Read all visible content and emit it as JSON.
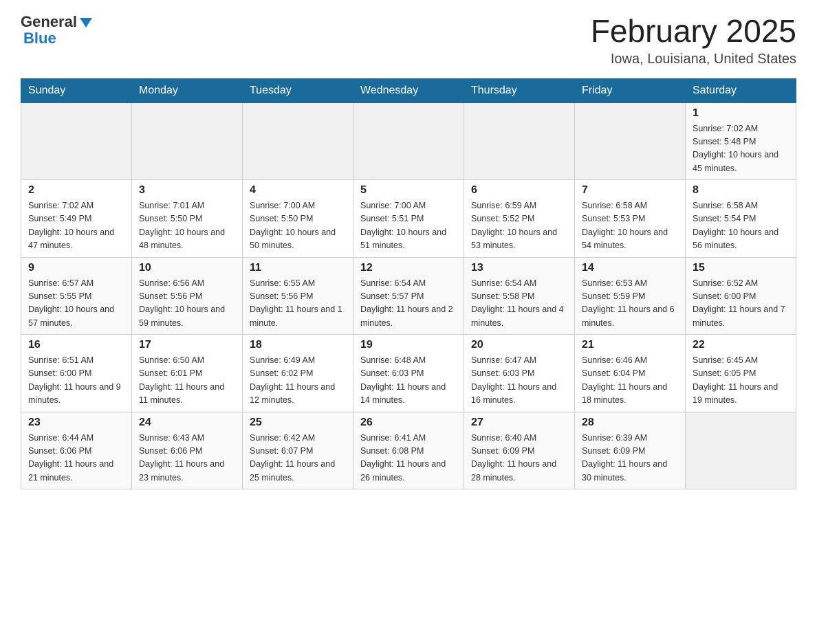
{
  "header": {
    "logo_general": "General",
    "logo_blue": "Blue",
    "month_title": "February 2025",
    "location": "Iowa, Louisiana, United States"
  },
  "days_of_week": [
    "Sunday",
    "Monday",
    "Tuesday",
    "Wednesday",
    "Thursday",
    "Friday",
    "Saturday"
  ],
  "weeks": [
    {
      "days": [
        {
          "number": "",
          "info": ""
        },
        {
          "number": "",
          "info": ""
        },
        {
          "number": "",
          "info": ""
        },
        {
          "number": "",
          "info": ""
        },
        {
          "number": "",
          "info": ""
        },
        {
          "number": "",
          "info": ""
        },
        {
          "number": "1",
          "info": "Sunrise: 7:02 AM\nSunset: 5:48 PM\nDaylight: 10 hours\nand 45 minutes."
        }
      ]
    },
    {
      "days": [
        {
          "number": "2",
          "info": "Sunrise: 7:02 AM\nSunset: 5:49 PM\nDaylight: 10 hours\nand 47 minutes."
        },
        {
          "number": "3",
          "info": "Sunrise: 7:01 AM\nSunset: 5:50 PM\nDaylight: 10 hours\nand 48 minutes."
        },
        {
          "number": "4",
          "info": "Sunrise: 7:00 AM\nSunset: 5:50 PM\nDaylight: 10 hours\nand 50 minutes."
        },
        {
          "number": "5",
          "info": "Sunrise: 7:00 AM\nSunset: 5:51 PM\nDaylight: 10 hours\nand 51 minutes."
        },
        {
          "number": "6",
          "info": "Sunrise: 6:59 AM\nSunset: 5:52 PM\nDaylight: 10 hours\nand 53 minutes."
        },
        {
          "number": "7",
          "info": "Sunrise: 6:58 AM\nSunset: 5:53 PM\nDaylight: 10 hours\nand 54 minutes."
        },
        {
          "number": "8",
          "info": "Sunrise: 6:58 AM\nSunset: 5:54 PM\nDaylight: 10 hours\nand 56 minutes."
        }
      ]
    },
    {
      "days": [
        {
          "number": "9",
          "info": "Sunrise: 6:57 AM\nSunset: 5:55 PM\nDaylight: 10 hours\nand 57 minutes."
        },
        {
          "number": "10",
          "info": "Sunrise: 6:56 AM\nSunset: 5:56 PM\nDaylight: 10 hours\nand 59 minutes."
        },
        {
          "number": "11",
          "info": "Sunrise: 6:55 AM\nSunset: 5:56 PM\nDaylight: 11 hours\nand 1 minute."
        },
        {
          "number": "12",
          "info": "Sunrise: 6:54 AM\nSunset: 5:57 PM\nDaylight: 11 hours\nand 2 minutes."
        },
        {
          "number": "13",
          "info": "Sunrise: 6:54 AM\nSunset: 5:58 PM\nDaylight: 11 hours\nand 4 minutes."
        },
        {
          "number": "14",
          "info": "Sunrise: 6:53 AM\nSunset: 5:59 PM\nDaylight: 11 hours\nand 6 minutes."
        },
        {
          "number": "15",
          "info": "Sunrise: 6:52 AM\nSunset: 6:00 PM\nDaylight: 11 hours\nand 7 minutes."
        }
      ]
    },
    {
      "days": [
        {
          "number": "16",
          "info": "Sunrise: 6:51 AM\nSunset: 6:00 PM\nDaylight: 11 hours\nand 9 minutes."
        },
        {
          "number": "17",
          "info": "Sunrise: 6:50 AM\nSunset: 6:01 PM\nDaylight: 11 hours\nand 11 minutes."
        },
        {
          "number": "18",
          "info": "Sunrise: 6:49 AM\nSunset: 6:02 PM\nDaylight: 11 hours\nand 12 minutes."
        },
        {
          "number": "19",
          "info": "Sunrise: 6:48 AM\nSunset: 6:03 PM\nDaylight: 11 hours\nand 14 minutes."
        },
        {
          "number": "20",
          "info": "Sunrise: 6:47 AM\nSunset: 6:03 PM\nDaylight: 11 hours\nand 16 minutes."
        },
        {
          "number": "21",
          "info": "Sunrise: 6:46 AM\nSunset: 6:04 PM\nDaylight: 11 hours\nand 18 minutes."
        },
        {
          "number": "22",
          "info": "Sunrise: 6:45 AM\nSunset: 6:05 PM\nDaylight: 11 hours\nand 19 minutes."
        }
      ]
    },
    {
      "days": [
        {
          "number": "23",
          "info": "Sunrise: 6:44 AM\nSunset: 6:06 PM\nDaylight: 11 hours\nand 21 minutes."
        },
        {
          "number": "24",
          "info": "Sunrise: 6:43 AM\nSunset: 6:06 PM\nDaylight: 11 hours\nand 23 minutes."
        },
        {
          "number": "25",
          "info": "Sunrise: 6:42 AM\nSunset: 6:07 PM\nDaylight: 11 hours\nand 25 minutes."
        },
        {
          "number": "26",
          "info": "Sunrise: 6:41 AM\nSunset: 6:08 PM\nDaylight: 11 hours\nand 26 minutes."
        },
        {
          "number": "27",
          "info": "Sunrise: 6:40 AM\nSunset: 6:09 PM\nDaylight: 11 hours\nand 28 minutes."
        },
        {
          "number": "28",
          "info": "Sunrise: 6:39 AM\nSunset: 6:09 PM\nDaylight: 11 hours\nand 30 minutes."
        },
        {
          "number": "",
          "info": ""
        }
      ]
    }
  ]
}
